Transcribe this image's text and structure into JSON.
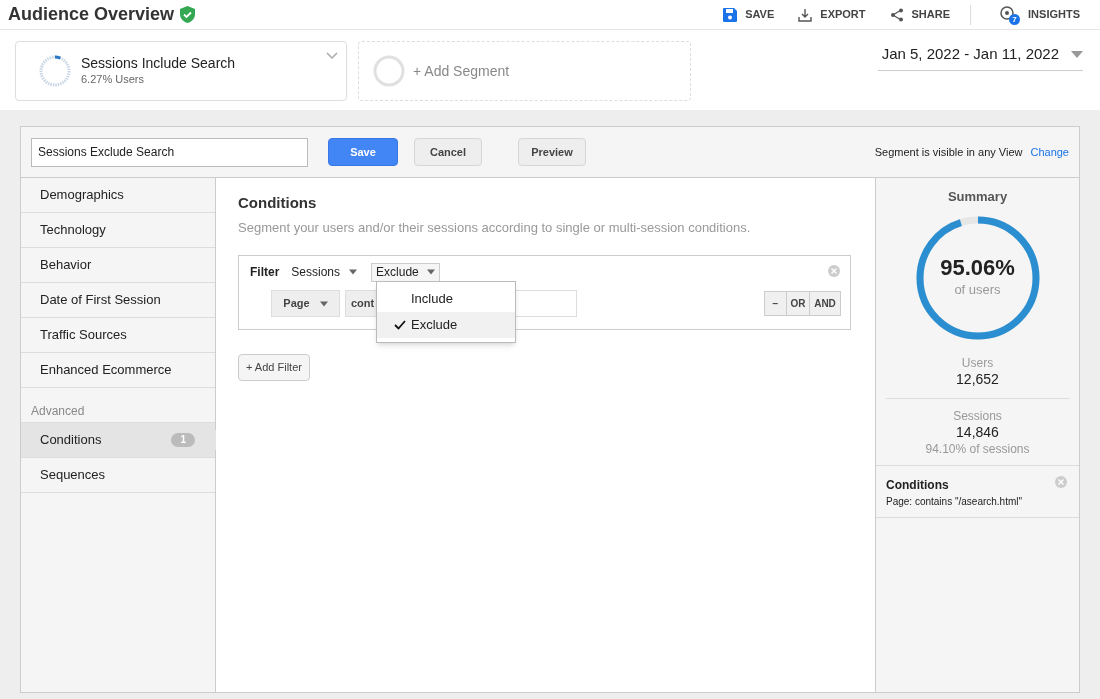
{
  "header": {
    "title": "Audience Overview",
    "actions": [
      {
        "kind": "save",
        "label": "SAVE"
      },
      {
        "kind": "export",
        "label": "EXPORT"
      },
      {
        "kind": "share",
        "label": "SHARE"
      },
      {
        "kind": "insights",
        "label": "INSIGHTS",
        "badge": "7"
      }
    ]
  },
  "segments": [
    {
      "kind": "segment",
      "name": "Sessions Include Search",
      "detail": "6.27% Users",
      "level": 0.0627
    },
    {
      "kind": "add",
      "name": "+ Add Segment"
    }
  ],
  "date_range": "Jan 5, 2022 - Jan 11, 2022",
  "editor": {
    "name_value": "Sessions Exclude Search",
    "buttons": [
      {
        "kind": "primary",
        "label": "Save"
      },
      {
        "kind": "plain",
        "label": "Cancel"
      },
      {
        "kind": "plain",
        "label": "Preview"
      }
    ],
    "visibility": "Segment is visible in any View",
    "visibility_link": "Change"
  },
  "sidebar": {
    "items": [
      {
        "label": "Demographics",
        "selected": false
      },
      {
        "label": "Technology",
        "selected": false
      },
      {
        "label": "Behavior",
        "selected": false
      },
      {
        "label": "Date of First Session",
        "selected": false
      },
      {
        "label": "Traffic Sources",
        "selected": false
      },
      {
        "label": "Enhanced Ecommerce",
        "selected": false
      }
    ],
    "advanced_label": "Advanced",
    "advanced_items": [
      {
        "label": "Conditions",
        "count": "1",
        "selected": true
      },
      {
        "label": "Sequences",
        "selected": false
      }
    ]
  },
  "conditions": {
    "title": "Conditions",
    "subtitle": "Segment your users and/or their sessions according to single or multi-session conditions.",
    "filter": {
      "label": "Filter",
      "scope": "Sessions",
      "mode": "Exclude",
      "dimension": "Page",
      "operator": "cont",
      "combinators": [
        "−",
        "OR",
        "AND"
      ]
    },
    "dropdown": [
      {
        "label": "Include",
        "selected": false
      },
      {
        "label": "Exclude",
        "selected": true
      }
    ],
    "add_filter": "+ Add Filter"
  },
  "summary": {
    "title": "Summary",
    "level": 0.9506,
    "percent": "95.06%",
    "percent_caption": "of users",
    "users_label": "Users",
    "users": "12,652",
    "sessions_label": "Sessions",
    "sessions": "14,846",
    "sessions_share": "94.10% of sessions",
    "condition_title": "Conditions",
    "condition_text": "Page: contains \"/asearch.html\""
  }
}
